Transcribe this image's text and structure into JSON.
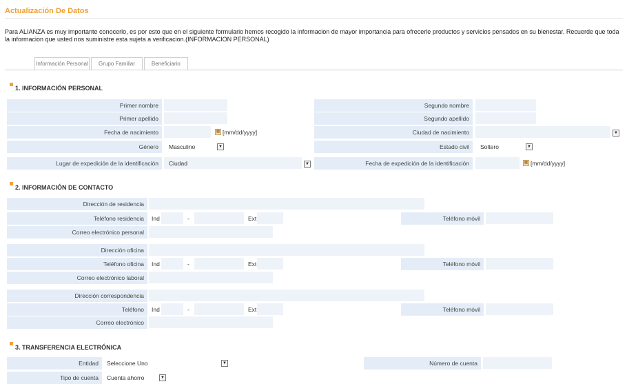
{
  "page": {
    "title": "Actualización De Datos",
    "intro": "Para ALIANZA es muy importante conocerlo, es por esto que en el siguiente formulario hemos recogido la informacion de mayor importancia para ofrecerle productos y servicios pensados en su bienestar. Recuerde que toda la informacion que usted nos suministre esta sujeta a verificacion.(INFORMACION PERSONAL)"
  },
  "tabs": [
    "Información Personal",
    "Grupo Familiar",
    "Beneficiario"
  ],
  "sections": {
    "personal": "1. INFORMACIÓN PERSONAL",
    "contacto": "2. INFORMACIÓN DE CONTACTO",
    "transferencia": "3. TRANSFERENCIA ELECTRÓNICA"
  },
  "personal": {
    "primer_nombre": "Primer nombre",
    "segundo_nombre": "Segundo nombre",
    "primer_apellido": "Primer apellido",
    "segundo_apellido": "Segundo apellido",
    "fecha_nacimiento": "Fecha de nacimiento",
    "ciudad_nacimiento": "Ciudad de nacimiento",
    "genero": "Género",
    "genero_value": "Masculino",
    "estado_civil": "Estado civil",
    "estado_civil_value": "Soltero",
    "lugar_expedicion": "Lugar de expedición de la identificación",
    "lugar_expedicion_value": "Ciudad",
    "fecha_expedicion": "Fecha de expedición de la identificación",
    "date_format": "[mm/dd/yyyy]"
  },
  "contacto": {
    "dir_residencia": "Dirección de residencia",
    "tel_residencia": "Teléfono residencia",
    "correo_personal": "Correo electrónico personal",
    "dir_oficina": "Dirección oficina",
    "tel_oficina": "Teléfono oficina",
    "correo_laboral": "Correo electrónico laboral",
    "dir_correspondencia": "Dirección correspondencia",
    "telefono": "Teléfono",
    "correo": "Correo electrónico",
    "movil": "Teléfono móvil",
    "ind": "Ind",
    "dash": "-",
    "ext": "Ext"
  },
  "transferencia": {
    "entidad": "Entidad",
    "entidad_value": "Seleccione Uno",
    "numero_cuenta": "Número de cuenta",
    "tipo_cuenta": "Tipo de cuenta",
    "tipo_cuenta_value": "Cuenta ahorro"
  },
  "icons": {
    "select": "dropdown-arrow-icon",
    "calendar": "calendar-icon"
  }
}
